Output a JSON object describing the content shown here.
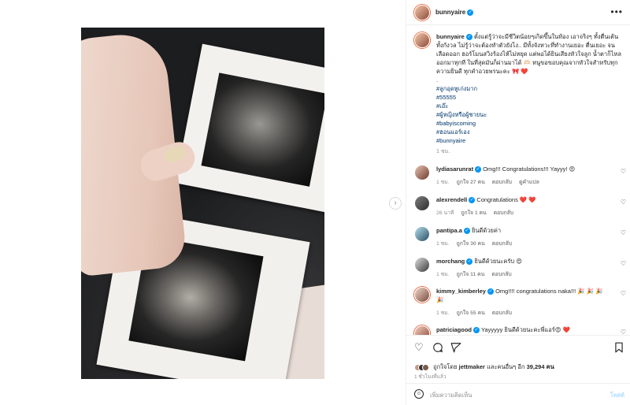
{
  "header": {
    "username": "bunnyaire",
    "more": "•••"
  },
  "caption": {
    "username": "bunnyaire",
    "text": "ตั้งแต่รู้ว่าจะมีชีวิตน้อยๆเกิดขึ้นในท้อง เอาจริงๆ ทั้งตื่นเต้น ทั้งกังวล ไม่รู้ว่าจะต้องทำตัวยังไง.. มีทั้งจังหวะที่ทำงานเยอะ ตื่นเยอะ จนเลือดออก ฮอร์โมนสวิงร้องไห้ไม่หยุด แต่พอได้ยินเสียงหัวใจลูก น้ำตาก็ไหลออกมาทุกที ในที่สุดมันก็ผ่านมาได้ 🫶🏻 หนูขอขอบคุณจากหัวใจสำหรับทุกความยินดี ทุกคำอวยพรนะคะ 🎀 ❤️",
    "dot": ".",
    "hashtags": [
      "#ลูกอุดหูเก่งมาก",
      "#55555",
      "#เอ๊ะ",
      "#ผู้หญิงหรือผู้ชายนะ",
      "#babyiscoming",
      "#ฮอนแอร์เอง",
      "#bunnyaire"
    ],
    "time": "1 ชม."
  },
  "comments": [
    {
      "username": "lydiasarunrat",
      "text": "Omg!!! Congratulations!!! Yayyy! 😍",
      "time": "1 ชม.",
      "likes": "ถูกใจ 27 คน",
      "reply": "ตอบกลับ",
      "translate": "ดูคำแปล"
    },
    {
      "username": "alexrendell",
      "text": "Congratulations ❤️ ❤️",
      "time": "26 นาที",
      "likes": "ถูกใจ 1 คน",
      "reply": "ตอบกลับ"
    },
    {
      "username": "pantipa.a",
      "text": "ยินดีด้วยค่า",
      "time": "1 ชม.",
      "likes": "ถูกใจ 30 คน",
      "reply": "ตอบกลับ"
    },
    {
      "username": "morchang",
      "text": "ยินดีด้วยนะครับ 😍",
      "time": "1 ชม.",
      "likes": "ถูกใจ 11 คน",
      "reply": "ตอบกลับ"
    },
    {
      "username": "kimmy_kimberley",
      "text": "Omg!!!! congratulations naka!!! 🎉 🎉 🎉 🎉",
      "time": "1 ชม.",
      "likes": "ถูกใจ 55 คน",
      "reply": "ตอบกลับ"
    },
    {
      "username": "patriciagood",
      "text": "Yayyyyy ยินดีด้วยนะคะพี่แอร์😍 ❤️"
    }
  ],
  "actions": {
    "like_icon": "heart-outline-icon",
    "comment_icon": "comment-bubble-icon",
    "share_icon": "paper-plane-icon",
    "save_icon": "bookmark-icon"
  },
  "likes": {
    "prefix": "ถูกใจโดย",
    "user": "jettmaker",
    "middle": "และคนอื่นๆ อีก",
    "count": "39,294 คน"
  },
  "post_time": "1 ชั่วโมงที่แล้ว",
  "add_comment": {
    "placeholder": "เพิ่มความคิดเห็น",
    "post": "โพสต์"
  },
  "colors": {
    "link": "#00376b",
    "verified": "#0095f6",
    "muted": "#8e8e8e",
    "post_disabled": "#b2dffc"
  }
}
